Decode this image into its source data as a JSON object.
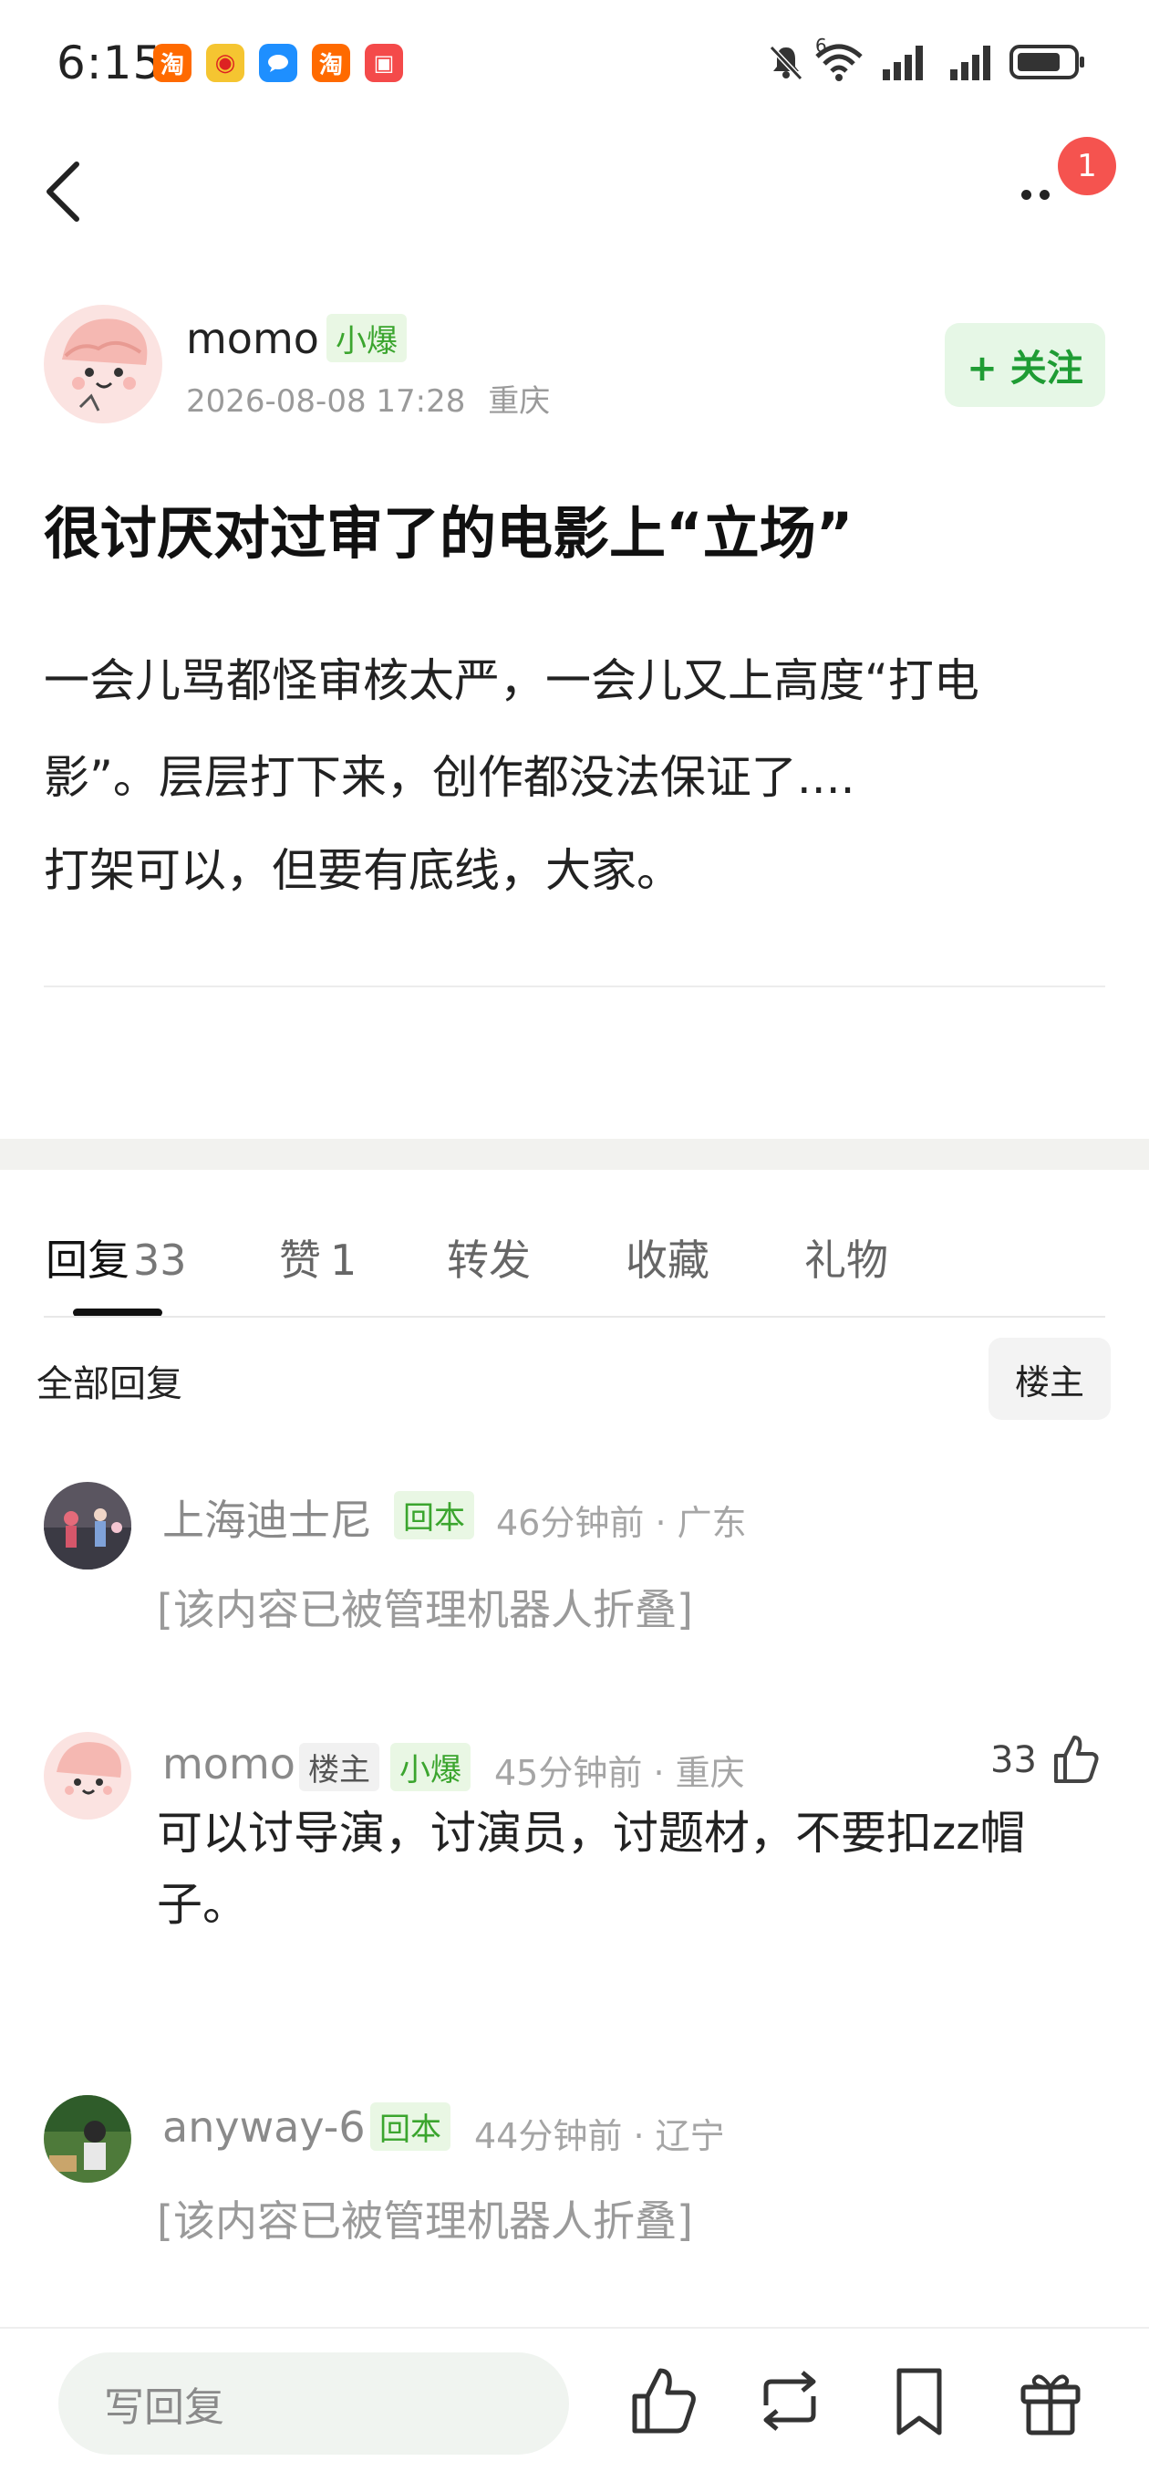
{
  "status_bar": {
    "time": "6:15",
    "notification_apps": [
      {
        "icon": "taobao-icon",
        "glyph": "淘",
        "color": "#ff6a00"
      },
      {
        "icon": "weibo-icon",
        "glyph": "◉",
        "color": "#f5b731"
      },
      {
        "icon": "chat-bubble-icon",
        "glyph": "💬",
        "color": "#1e8fff"
      },
      {
        "icon": "taobao-icon",
        "glyph": "淘",
        "color": "#ff6a00"
      },
      {
        "icon": "red-app-icon",
        "glyph": "▣",
        "color": "#f44a4a"
      }
    ],
    "signal_label": "6"
  },
  "nav": {
    "notification_badge": "1"
  },
  "post": {
    "author": "momo",
    "author_tag": "小爆",
    "date": "2026-08-08 17:28",
    "location": "重庆",
    "follow_label": "+ 关注",
    "title": "很讨厌对过审了的电影上“立场”",
    "body_lines": [
      "一会儿骂都怪审核太严，一会儿又上高度“打电",
      "影”。层层打下来，创作都没法保证了....",
      "打架可以，但要有底线，大家。"
    ]
  },
  "tabs": [
    {
      "label": "回复",
      "count": "33"
    },
    {
      "label": "赞",
      "count": "1"
    },
    {
      "label": "转发",
      "count": ""
    },
    {
      "label": "收藏",
      "count": ""
    },
    {
      "label": "礼物",
      "count": ""
    }
  ],
  "filter": {
    "all_replies": "全部回复",
    "op_only": "楼主"
  },
  "comments": [
    {
      "user": "上海迪士尼",
      "tags": [
        "回本"
      ],
      "time": "46分钟前",
      "location": "广东",
      "text": "[该内容已被管理机器人折叠]"
    },
    {
      "user": "momo",
      "tags": [
        "楼主",
        "小爆"
      ],
      "time": "45分钟前",
      "location": "重庆",
      "likes": "33",
      "text_lines": [
        "可以讨导演，讨演员，讨题材，不要扣zz帽",
        "子。"
      ]
    },
    {
      "user": "anyway-6",
      "tags": [
        "回本"
      ],
      "time": "44分钟前",
      "location": "辽宁",
      "text": "[该内容已被管理机器人折叠]"
    }
  ],
  "bottom_bar": {
    "reply_placeholder": "写回复",
    "icons": [
      "thumbs-up-icon",
      "repost-icon",
      "bookmark-icon",
      "gift-icon"
    ]
  },
  "colors": {
    "accent_green": "#3ba52e",
    "follow_green": "#1f9c34",
    "badge_red": "#f5534f"
  }
}
